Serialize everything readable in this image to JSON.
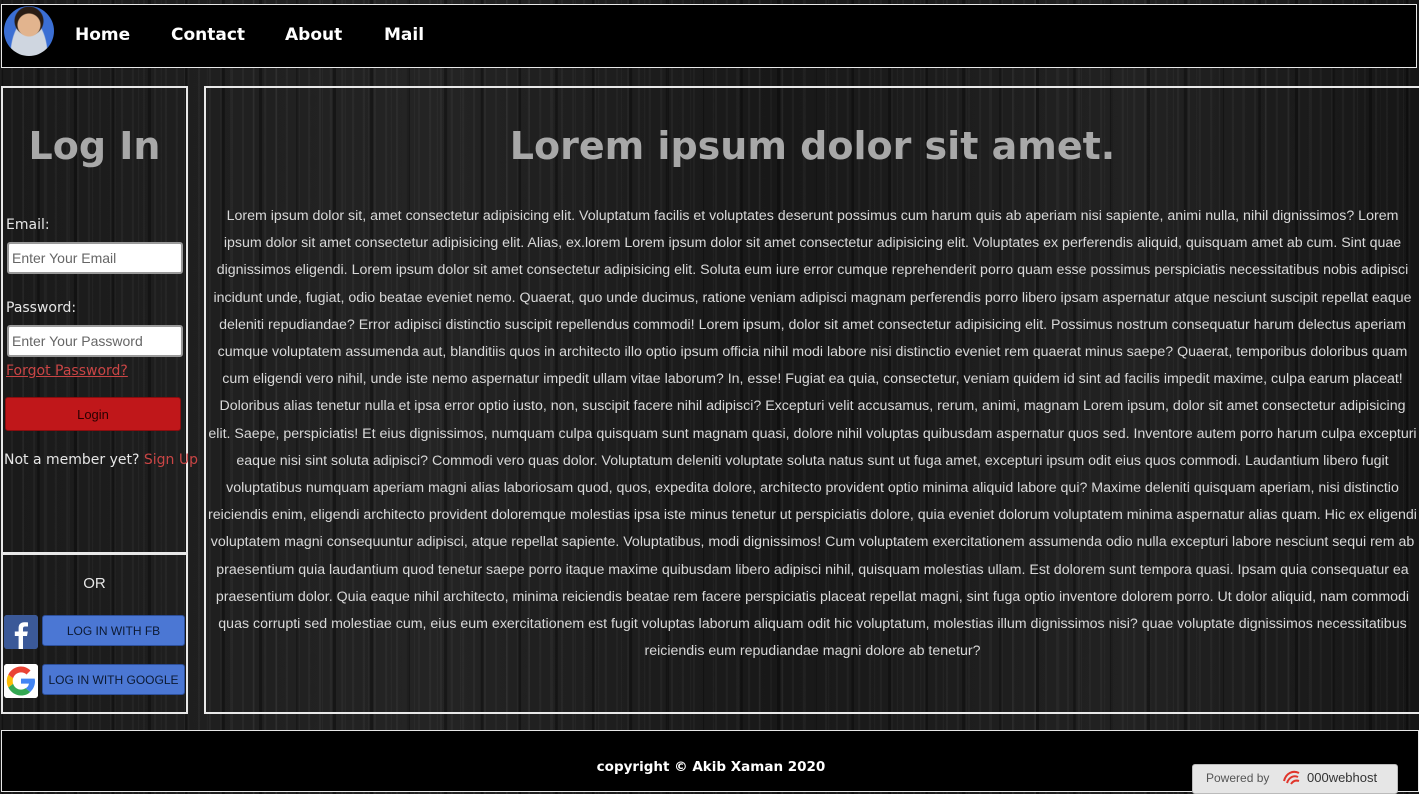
{
  "nav": {
    "items": [
      "Home",
      "Contact",
      "About",
      "Mail"
    ]
  },
  "login": {
    "title": "Log In",
    "email_label": "Email:",
    "email_placeholder": "Enter Your Email",
    "password_label": "Password:",
    "password_placeholder": "Enter Your Password",
    "forgot_link": "Forgot Password?",
    "login_button": "Login",
    "not_member_text": "Not a member yet?",
    "signup_link": "Sign Up"
  },
  "social": {
    "or_text": "OR",
    "fb_button": "LOG IN WITH FB",
    "google_button": "LOG IN WITH GOOGLE",
    "fb_icon": "facebook-icon",
    "google_icon": "google-icon"
  },
  "main": {
    "title": "Lorem ipsum dolor sit amet.",
    "body": "Lorem ipsum dolor sit, amet consectetur adipisicing elit. Voluptatum facilis et voluptates deserunt possimus cum harum quis ab aperiam nisi sapiente, animi nulla, nihil dignissimos? Lorem ipsum dolor sit amet consectetur adipisicing elit. Alias, ex.lorem Lorem ipsum dolor sit amet consectetur adipisicing elit. Voluptates ex perferendis aliquid, quisquam amet ab cum. Sint quae dignissimos eligendi. Lorem ipsum dolor sit amet consectetur adipisicing elit. Soluta eum iure error cumque reprehenderit porro quam esse possimus perspiciatis necessitatibus nobis adipisci incidunt unde, fugiat, odio beatae eveniet nemo. Quaerat, quo unde ducimus, ratione veniam adipisci magnam perferendis porro libero ipsam aspernatur atque nesciunt suscipit repellat eaque deleniti repudiandae? Error adipisci distinctio suscipit repellendus commodi! Lorem ipsum, dolor sit amet consectetur adipisicing elit. Possimus nostrum consequatur harum delectus aperiam cumque voluptatem assumenda aut, blanditiis quos in architecto illo optio ipsum officia nihil modi labore nisi distinctio eveniet rem quaerat minus saepe? Quaerat, temporibus doloribus quam cum eligendi vero nihil, unde iste nemo aspernatur impedit ullam vitae laborum? In, esse! Fugiat ea quia, consectetur, veniam quidem id sint ad facilis impedit maxime, culpa earum placeat! Doloribus alias tenetur nulla et ipsa error optio iusto, non, suscipit facere nihil adipisci? Excepturi velit accusamus, rerum, animi, magnam Lorem ipsum, dolor sit amet consectetur adipisicing elit. Saepe, perspiciatis! Et eius dignissimos, numquam culpa quisquam sunt magnam quasi, dolore nihil voluptas quibusdam aspernatur quos sed. Inventore autem porro harum culpa excepturi eaque nisi sint soluta adipisci? Commodi vero quas dolor. Voluptatum deleniti voluptate soluta natus sunt ut fuga amet, excepturi ipsum odit eius quos commodi. Laudantium libero fugit voluptatibus numquam aperiam magni alias laboriosam quod, quos, expedita dolore, architecto provident optio minima aliquid labore qui? Maxime deleniti quisquam aperiam, nisi distinctio reiciendis enim, eligendi architecto provident doloremque molestias ipsa iste minus tenetur ut perspiciatis dolore, quia eveniet dolorum voluptatem minima aspernatur alias quam. Hic ex eligendi voluptatem magni consequuntur adipisci, atque repellat sapiente. Voluptatibus, modi dignissimos! Cum voluptatem exercitationem assumenda odio nulla excepturi labore nesciunt sequi rem ab praesentium quia laudantium quod tenetur saepe porro itaque maxime quibusdam libero adipisci nihil, quisquam molestias ullam. Est dolorem sunt tempora quasi. Ipsam quia consequatur ea praesentium dolor. Quia eaque nihil architecto, minima reiciendis beatae rem facere perspiciatis placeat repellat magni, sint fuga optio inventore dolorem porro. Ut dolor aliquid, nam commodi quas corrupti sed molestiae cum, eius eum exercitationem est fugit voluptas laborum aliquam odit hic voluptatum, molestias illum dignissimos nisi? quae voluptate dignissimos necessitatibus reiciendis eum repudiandae magni dolore ab tenetur?"
  },
  "footer": {
    "copyright": "copyright © Akib Xaman 2020",
    "host_powered": "Powered by",
    "host_name": "000webhost",
    "host_icon": "000webhost-logo-icon"
  }
}
